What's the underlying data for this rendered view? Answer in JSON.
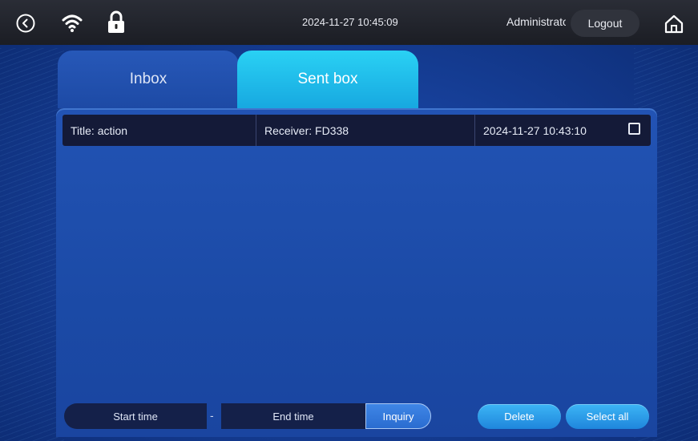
{
  "header": {
    "datetime": "2024-11-27 10:45:09",
    "user": "Administrator",
    "logout_label": "Logout",
    "icons": [
      "back-icon",
      "wifi-icon",
      "lock-icon",
      "home-icon"
    ]
  },
  "tabs": [
    {
      "label": "Inbox",
      "active": false
    },
    {
      "label": "Sent box",
      "active": true
    }
  ],
  "messages": [
    {
      "title_label": "Title:",
      "title": "action",
      "receiver_label": "Receiver:",
      "receiver": "FD338",
      "time": "2024-11-27 10:43:10",
      "checked": false
    }
  ],
  "filters": {
    "start_time_placeholder": "Start time",
    "separator": "-",
    "end_time_placeholder": "End time",
    "inquiry_label": "Inquiry"
  },
  "actions": {
    "delete_label": "Delete",
    "select_all_label": "Select all"
  },
  "colors": {
    "active_tab": "#22bff0",
    "button": "#2b9bea",
    "background": "#1a4aa6"
  }
}
